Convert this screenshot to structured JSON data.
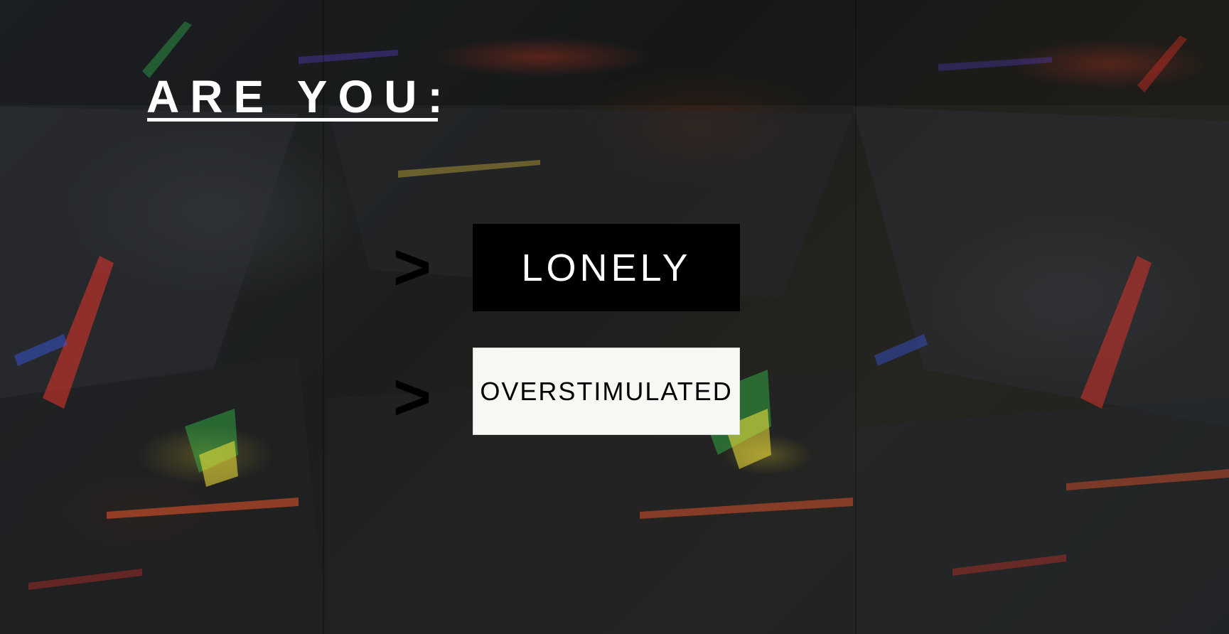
{
  "heading": {
    "text": "ARE YOU:"
  },
  "options": [
    {
      "arrow": ">",
      "label": "LONELY",
      "style": "dark"
    },
    {
      "arrow": ">",
      "label": "OVERSTIMULATED",
      "style": "light"
    }
  ],
  "colors": {
    "heading": "#ffffff",
    "dark_button_bg": "#000000",
    "dark_button_text": "#ffffff",
    "light_button_bg": "#f6f8f4",
    "light_button_text": "#000000",
    "arrow": "#000000"
  }
}
